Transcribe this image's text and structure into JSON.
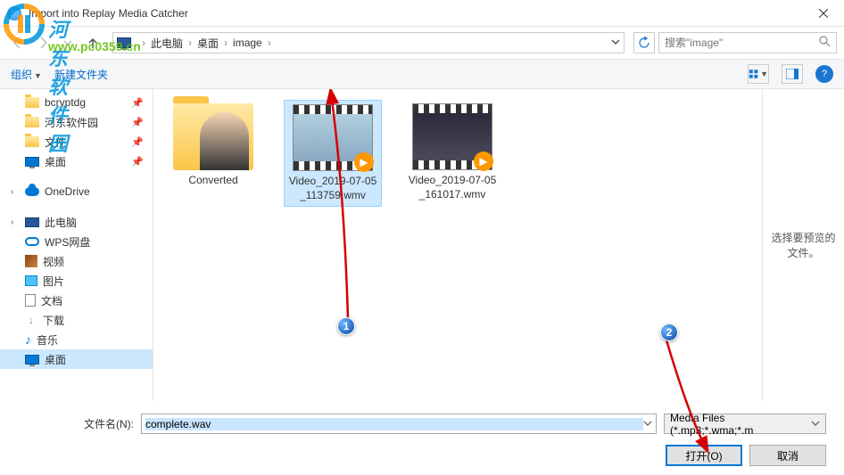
{
  "window": {
    "title": "Import into Replay Media Catcher"
  },
  "watermark": {
    "brand": "河东软件园",
    "url": "www.pc0359.cn"
  },
  "breadcrumb": {
    "parts": [
      "此电脑",
      "桌面",
      "image"
    ]
  },
  "search": {
    "placeholder": "搜索\"image\""
  },
  "toolbar": {
    "organize": "组织",
    "newfolder": "新建文件夹"
  },
  "sidebar": {
    "items": [
      {
        "label": "bcryptdg",
        "type": "folder",
        "pinned": true
      },
      {
        "label": "河东软件园",
        "type": "folder",
        "pinned": true
      },
      {
        "label": "文件",
        "type": "folder",
        "pinned": true
      },
      {
        "label": "桌面",
        "type": "desktop",
        "pinned": true
      },
      {
        "label": "OneDrive",
        "type": "cloud",
        "chev": true
      },
      {
        "label": "此电脑",
        "type": "pc",
        "chev": true
      },
      {
        "label": "WPS网盘",
        "type": "wps"
      },
      {
        "label": "视频",
        "type": "vid"
      },
      {
        "label": "图片",
        "type": "img"
      },
      {
        "label": "文档",
        "type": "doc"
      },
      {
        "label": "下载",
        "type": "dl"
      },
      {
        "label": "音乐",
        "type": "music"
      },
      {
        "label": "桌面",
        "type": "desktop",
        "selected": true
      }
    ]
  },
  "files": [
    {
      "name": "Converted",
      "kind": "folder"
    },
    {
      "name": "Video_2019-07-05_113759.wmv",
      "kind": "video",
      "selected": true,
      "frame": "f1"
    },
    {
      "name": "Video_2019-07-05_161017.wmv",
      "kind": "video",
      "frame": "f2"
    }
  ],
  "preview": {
    "text": "选择要预览的文件。"
  },
  "footer": {
    "filename_label": "文件名(N):",
    "filename_value": "complete.wav",
    "filter": "Media Files (*.mp3;*.wma;*.m",
    "open": "打开(O)",
    "cancel": "取消"
  },
  "markers": {
    "one": "1",
    "two": "2"
  }
}
